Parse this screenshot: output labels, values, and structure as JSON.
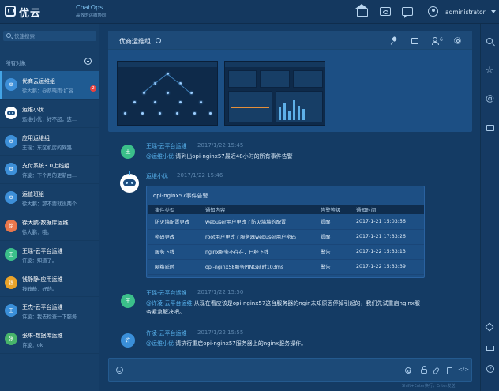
{
  "header": {
    "logo_text": "优云",
    "app_title": "ChatOps",
    "app_subtitle": "高效的运维协同",
    "user_name": "administrator"
  },
  "sidebar": {
    "search_placeholder": "快速搜索",
    "section_label": "所有对象",
    "items": [
      {
        "name": "优商云运维组",
        "preview": "徐大鹏：@蔡晓雨:扩容...",
        "avatar": "robot-blue",
        "badge": "2",
        "active": true
      },
      {
        "name": "运维小优",
        "preview": "运维小优：好不超，这...",
        "avatar": "robot"
      },
      {
        "name": "应用运维组",
        "preview": "王瑶：东区机房的网路...",
        "avatar": "robot-blue"
      },
      {
        "name": "支付系统3.0上线组",
        "preview": "许凌：下个月的更新由...",
        "avatar": "robot-blue"
      },
      {
        "name": "运值班组",
        "preview": "徐大鹏：那不要就说两个...",
        "avatar": "robot-blue"
      },
      {
        "name": "徐大鹏-数据库运维",
        "preview": "徐大鹏：哦。",
        "avatar_text": "徐",
        "color": "#e8774c"
      },
      {
        "name": "王瑶-云平台运维",
        "preview": "许凌：知道了。",
        "avatar_text": "王",
        "color": "#3bbf8a"
      },
      {
        "name": "钱静静-应用运维",
        "preview": "钱静静：好的。",
        "avatar_text": "钱",
        "color": "#e9a32a"
      },
      {
        "name": "王杰-云平台运维",
        "preview": "许凌：我去检查一下服务...",
        "avatar_text": "王",
        "color": "#3a8fd9"
      },
      {
        "name": "张琳-数据库运维",
        "preview": "许凌：ok",
        "avatar_text": "张",
        "color": "#47b46a"
      }
    ]
  },
  "group": {
    "title": "优商运维组",
    "member_count": "6"
  },
  "messages": [
    {
      "avatar": "王",
      "sender": "王瑶-云平台运维",
      "time": "2017/1/22  15:45",
      "mention": "@运维小优",
      "text": "请列出opi-nginx57最近48小时的所有事件告警"
    },
    {
      "sender": "运维小优",
      "time": "2017/1/22  15:46",
      "card_title": "opi-nginx57事件告警"
    },
    {
      "avatar": "王",
      "sender": "王瑶-云平台运维",
      "time": "2017/1/22  15:50",
      "mention": "@许凌-云平台运维",
      "text_line1": "从现在看应该是opi-nginx57这台服务器的ngin未知原因停掉引起的，我们先试重启nginx服",
      "text_line2": "务紧急解决吧。"
    },
    {
      "avatar": "许",
      "sender": "许凌-云平台运维",
      "time": "2017/1/22  15:55",
      "mention": "@运维小优",
      "text": "请执行重启opi-nginx57服务器上的nginx服务操作。"
    }
  ],
  "alert_table": {
    "columns": [
      "事件类型",
      "通知内容",
      "告警等级",
      "通知时间"
    ],
    "rows": [
      [
        "防火墙配置更改",
        "webuser用户更改了防火墙墙的配置",
        "提醒",
        "2017-1-21    15:03:56"
      ],
      [
        "密码更改",
        "root用户更改了服务器webuser用户密码",
        "提醒",
        "2017-1-21    17:33:26"
      ],
      [
        "服务下线",
        "nginx服务不存在，已经下线",
        "警告",
        "2017-1-22    15:33:13"
      ],
      [
        "网络延时",
        "opi-nginx58服务PING延时103ms",
        "警告",
        "2017-1-22    15:33:39"
      ]
    ]
  },
  "composer": {
    "code_label": "</>",
    "footer_note": "Shift+Enter换行，Enter发送"
  },
  "rail": {
    "help_label": "?"
  }
}
